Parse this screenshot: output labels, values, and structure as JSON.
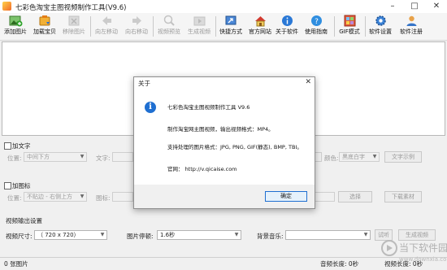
{
  "window": {
    "title": "七彩色淘宝主图视频制作工具(V9.6)",
    "minimize": "–",
    "maximize": "□",
    "close": "✕"
  },
  "toolbar": [
    {
      "id": "add-image",
      "label": "添加图片",
      "icon": "add-image-icon",
      "enabled": true
    },
    {
      "id": "load-baby",
      "label": "加载宝贝",
      "icon": "load-product-icon",
      "enabled": true
    },
    {
      "id": "remove-image",
      "label": "移除图片",
      "icon": "remove-image-icon",
      "enabled": false
    },
    {
      "id": "move-left",
      "label": "向左移动",
      "icon": "arrow-left-icon",
      "enabled": false
    },
    {
      "id": "move-right",
      "label": "向右移动",
      "icon": "arrow-right-icon",
      "enabled": false
    },
    {
      "id": "preview-video",
      "label": "视频预览",
      "icon": "preview-icon",
      "enabled": false
    },
    {
      "id": "generate-video",
      "label": "生成视频",
      "icon": "generate-video-icon",
      "enabled": false
    },
    {
      "id": "shortcuts",
      "label": "快捷方式",
      "icon": "shortcut-icon",
      "enabled": true
    },
    {
      "id": "website",
      "label": "官方网站",
      "icon": "home-icon",
      "enabled": true
    },
    {
      "id": "about",
      "label": "关于软件",
      "icon": "info-icon",
      "enabled": true
    },
    {
      "id": "guide",
      "label": "使用指南",
      "icon": "help-icon",
      "enabled": true
    },
    {
      "id": "gif-mode",
      "label": "GIF模式",
      "icon": "gif-icon",
      "enabled": true
    },
    {
      "id": "settings",
      "label": "软件设置",
      "icon": "gear-icon",
      "enabled": true
    },
    {
      "id": "register",
      "label": "软件注册",
      "icon": "user-icon",
      "enabled": true
    }
  ],
  "text_panel": {
    "checkbox_label": "加文字",
    "position_label": "位置:",
    "position_value": "中间下方",
    "text_label": "文字:",
    "color_label": "颜色:",
    "color_value": "黑底白字",
    "sample_button": "文字示例"
  },
  "icon_panel": {
    "checkbox_label": "加图标",
    "position_label": "位置:",
    "position_value": "不贴边 - 右侧上方",
    "icon_label": "图标:",
    "choose_button": "选择",
    "download_button": "下载素材"
  },
  "output": {
    "section_label": "视频输出设置",
    "size_label": "视频尺寸:",
    "size_value": "（   720  x   720）",
    "pause_label": "图片停顿:",
    "pause_value": "1.6秒",
    "music_label": "背景音乐:",
    "trial_button": "试听",
    "generate_button": "生成视频"
  },
  "status": {
    "image_count": "0 张图片",
    "audio_length": "音频长度: 0秒",
    "video_length": "视频长度: 0秒"
  },
  "dialog": {
    "title": "关于",
    "close": "✕",
    "icon": "i",
    "line1": "七彩色淘宝主图视频制作工具 V9.6",
    "line2": "制作淘宝网主图视频，输出视频格式：MP4。",
    "line3": "支持处理的图片格式：JPG, PNG, GIF(静态), BMP, TBI。",
    "line4": "官网： http://v.qicaise.com",
    "ok": "确定"
  },
  "watermark": {
    "text": "当下软件园",
    "sub": "www.downxia.com"
  },
  "colors": {
    "accent": "#1f6fd1",
    "toolbar_bg": "#f5f5f5",
    "panel_bg": "#f0f0f0"
  }
}
